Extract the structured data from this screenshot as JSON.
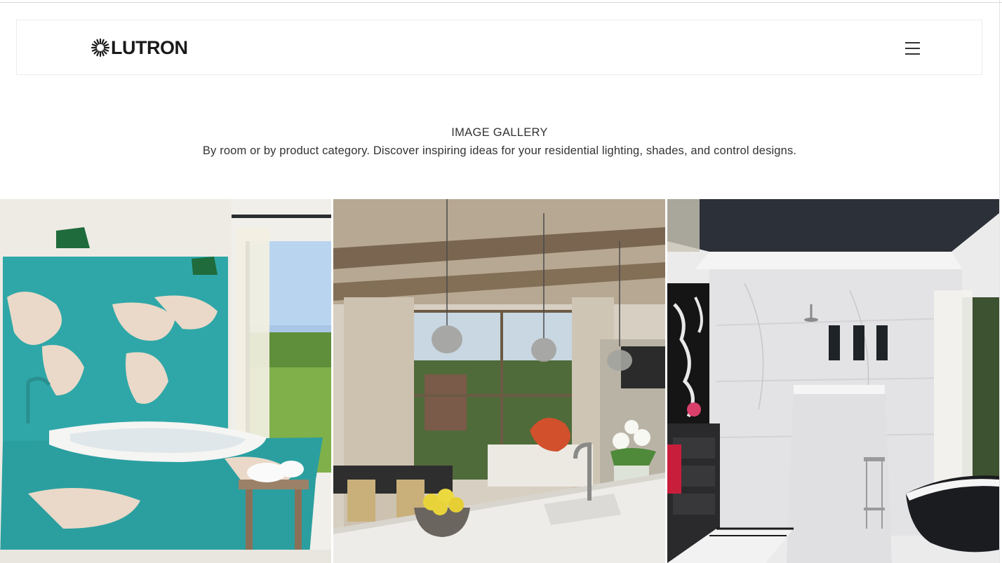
{
  "header": {
    "logo_text": "LUTRON",
    "menu_icon": "hamburger-menu-icon"
  },
  "intro": {
    "title": "IMAGE GALLERY",
    "description": "By room or by product category. Discover inspiring ideas for your residential lighting, shades, and control designs."
  },
  "gallery": {
    "tiles": [
      {
        "subject": "bathroom-world-map-tile-tub"
      },
      {
        "subject": "kitchen-living-room-pendant-lights"
      },
      {
        "subject": "marble-bathroom-clawfoot-tub"
      }
    ]
  },
  "colors": {
    "logo": "#1a1a1a",
    "text": "#333333",
    "header_border": "#ececec"
  }
}
